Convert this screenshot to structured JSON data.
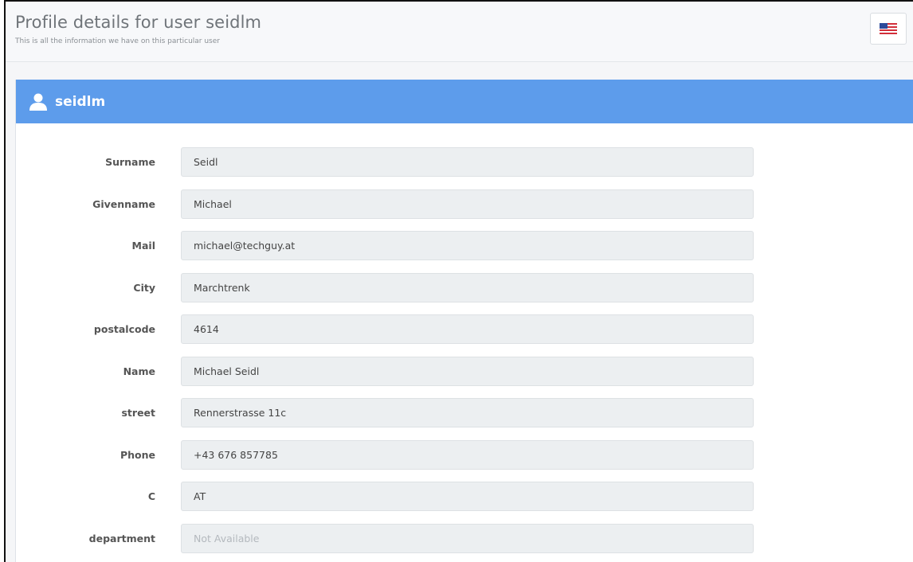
{
  "header": {
    "title": "Profile details for user seidlm",
    "subtitle": "This is all the information we have on this particular user",
    "language_icon": "us-flag-icon"
  },
  "panel": {
    "icon": "user-icon",
    "title": "seidlm",
    "accent_color": "#5d9ceb"
  },
  "fields": [
    {
      "label": "Surname",
      "value": "Seidl",
      "placeholder": ""
    },
    {
      "label": "Givenname",
      "value": "Michael",
      "placeholder": ""
    },
    {
      "label": "Mail",
      "value": "michael@techguy.at",
      "placeholder": ""
    },
    {
      "label": "City",
      "value": "Marchtrenk",
      "placeholder": ""
    },
    {
      "label": "postalcode",
      "value": "4614",
      "placeholder": ""
    },
    {
      "label": "Name",
      "value": "Michael Seidl",
      "placeholder": ""
    },
    {
      "label": "street",
      "value": "Rennerstrasse 11c",
      "placeholder": ""
    },
    {
      "label": "Phone",
      "value": "+43 676 857785",
      "placeholder": ""
    },
    {
      "label": "C",
      "value": "AT",
      "placeholder": ""
    },
    {
      "label": "department",
      "value": "",
      "placeholder": "Not Available"
    }
  ]
}
